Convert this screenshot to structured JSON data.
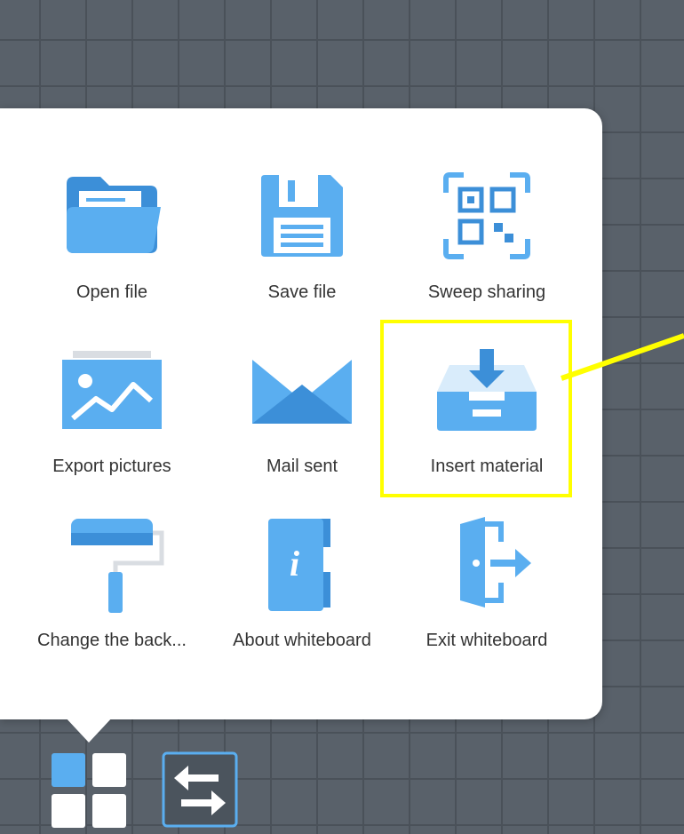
{
  "menu": {
    "items": [
      {
        "label": "Open file",
        "icon": "folder-icon"
      },
      {
        "label": "Save file",
        "icon": "floppy-disk-icon"
      },
      {
        "label": "Sweep sharing",
        "icon": "qr-code-icon"
      },
      {
        "label": "Export pictures",
        "icon": "picture-icon"
      },
      {
        "label": "Mail sent",
        "icon": "envelope-icon"
      },
      {
        "label": "Insert material",
        "icon": "inbox-download-icon"
      },
      {
        "label": "Change the back...",
        "icon": "paint-roller-icon"
      },
      {
        "label": "About whiteboard",
        "icon": "info-book-icon"
      },
      {
        "label": "Exit whiteboard",
        "icon": "exit-door-icon"
      }
    ]
  },
  "toolbar": {
    "menu_button_icon": "grid-menu-icon",
    "switch_button_icon": "swap-arrows-icon"
  },
  "colors": {
    "icon_blue": "#5aaef0",
    "icon_dark_blue": "#3c8fd8",
    "highlight": "#ffff00",
    "background": "#59616a"
  }
}
